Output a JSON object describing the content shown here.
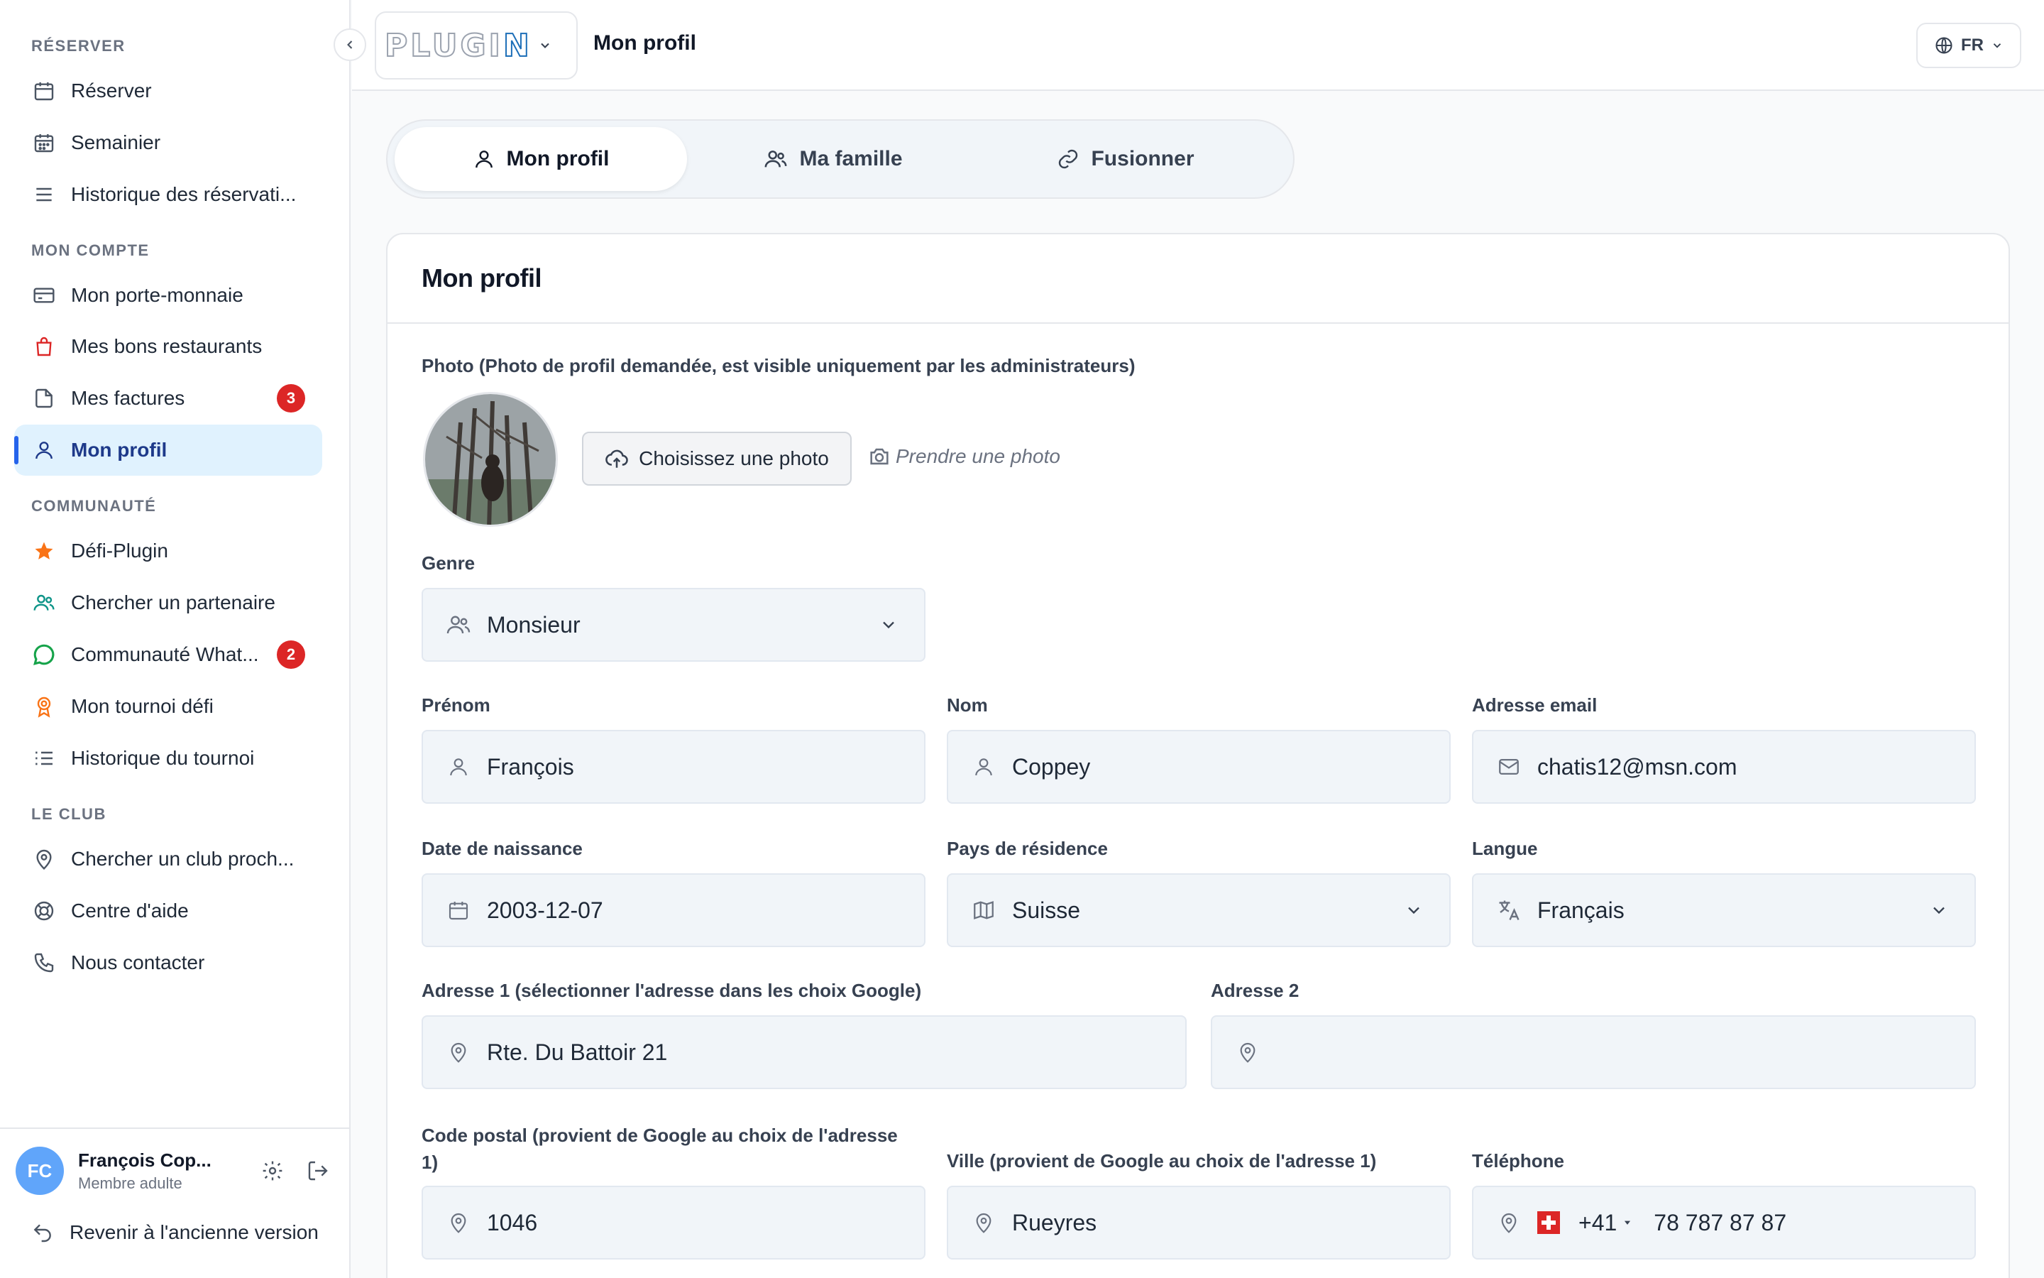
{
  "sidebar": {
    "sections": {
      "reserver": "RÉSERVER",
      "mon_compte": "MON COMPTE",
      "communaute": "COMMUNAUTÉ",
      "le_club": "LE CLUB"
    },
    "items": [
      {
        "label": "Réserver",
        "icon": "calendar-icon"
      },
      {
        "label": "Semainier",
        "icon": "calendar-grid-icon"
      },
      {
        "label": "Historique des réservati...",
        "icon": "list-icon"
      },
      {
        "label": "Mon porte-monnaie",
        "icon": "credit-card-icon"
      },
      {
        "label": "Mes bons restaurants",
        "icon": "shopping-bag-icon"
      },
      {
        "label": "Mes factures",
        "icon": "file-icon",
        "badge": "3"
      },
      {
        "label": "Mon profil",
        "icon": "user-icon"
      },
      {
        "label": "Défi-Plugin",
        "icon": "star-icon"
      },
      {
        "label": "Chercher un partenaire",
        "icon": "users-icon"
      },
      {
        "label": "Communauté What...",
        "icon": "whatsapp-icon",
        "badge": "2"
      },
      {
        "label": "Mon tournoi défi",
        "icon": "award-icon"
      },
      {
        "label": "Historique du tournoi",
        "icon": "list-ordered-icon"
      },
      {
        "label": "Chercher un club proch...",
        "icon": "map-pin-icon"
      },
      {
        "label": "Centre d'aide",
        "icon": "lifebuoy-icon"
      },
      {
        "label": "Nous contacter",
        "icon": "phone-icon"
      }
    ],
    "user": {
      "initials": "FC",
      "name": "François Cop...",
      "role": "Membre adulte"
    },
    "back_link": "Revenir à l'ancienne version"
  },
  "header": {
    "logo": "PLUGIN",
    "title": "Mon profil",
    "language": "FR"
  },
  "tabs": [
    {
      "label": "Mon profil",
      "icon": "user-icon"
    },
    {
      "label": "Ma famille",
      "icon": "users-icon"
    },
    {
      "label": "Fusionner",
      "icon": "link-icon"
    }
  ],
  "profile": {
    "card_title": "Mon profil",
    "photo_label": "Photo (Photo de profil demandée, est visible uniquement par les administrateurs)",
    "upload_label": "Choisissez une photo",
    "camera_label": "Prendre une photo",
    "genre": {
      "label": "Genre",
      "value": "Monsieur"
    },
    "prenom": {
      "label": "Prénom",
      "value": "François"
    },
    "nom": {
      "label": "Nom",
      "value": "Coppey"
    },
    "email": {
      "label": "Adresse email",
      "value": "chatis12@msn.com"
    },
    "birthdate": {
      "label": "Date de naissance",
      "value": "2003-12-07"
    },
    "country": {
      "label": "Pays de résidence",
      "value": "Suisse"
    },
    "language": {
      "label": "Langue",
      "value": "Français"
    },
    "address1": {
      "label": "Adresse 1 (sélectionner l'adresse dans les choix Google)",
      "value": "Rte. Du Battoir 21"
    },
    "address2": {
      "label": "Adresse 2",
      "value": ""
    },
    "postal": {
      "label_line1": "Code postal (provient de Google au choix de l'adresse",
      "label_line2": "1)",
      "value": "1046"
    },
    "city": {
      "label": "Ville (provient de Google au choix de l'adresse 1)",
      "value": "Rueyres"
    },
    "phone": {
      "label": "Téléphone",
      "dial_code": "+41",
      "value": "78 787 87 87"
    }
  },
  "colors": {
    "accent": "#2563eb",
    "active_bg": "#e0f2fe",
    "badge": "#dc2626",
    "field_bg": "#f1f5f9"
  }
}
